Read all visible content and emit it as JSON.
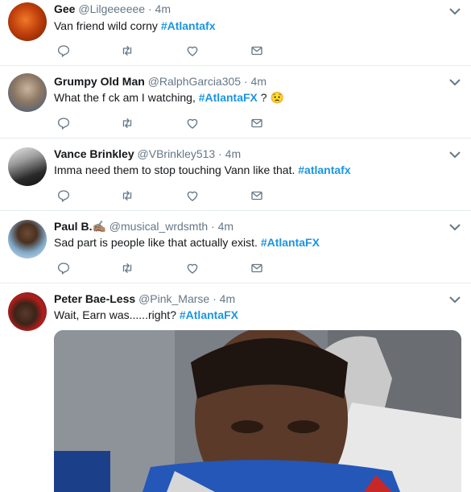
{
  "tweets": [
    {
      "name": "Gee",
      "handle": "@Lilgeeeeee",
      "separator": "·",
      "time": "4m",
      "text": "Van friend  wild corny ",
      "hashtag": "#Atlantafx",
      "after": ""
    },
    {
      "name": "Grumpy Old Man",
      "handle": "@RalphGarcia305",
      "separator": "·",
      "time": "4m",
      "text": "What the f  ck am I watching, ",
      "hashtag": "#AtlantaFX",
      "after": " ? ",
      "emoji": "😟"
    },
    {
      "name": "Vance Brinkley",
      "handle": "@VBrinkley513",
      "separator": "·",
      "time": "4m",
      "text": "Imma need them to stop touching Vann like that. ",
      "hashtag": "#atlantafx",
      "after": ""
    },
    {
      "name": "Paul B.",
      "name_emoji": "✍🏽",
      "handle": "@musical_wrdsmth",
      "separator": "·",
      "time": "4m",
      "text": "Sad part is people like that actually exist. ",
      "hashtag": "#AtlantaFX",
      "after": ""
    },
    {
      "name": "Peter Bae-Less",
      "handle": "@Pink_Marse",
      "separator": "·",
      "time": "4m",
      "text": "Wait, Earn was......right? ",
      "hashtag": "#AtlantaFX",
      "after": ""
    }
  ],
  "icons": {
    "reply": "reply-icon",
    "retweet": "retweet-icon",
    "like": "heart-icon",
    "dm": "envelope-icon",
    "caret": "chevron-down-icon"
  },
  "colors": {
    "hashtag": "#1b95e0",
    "muted": "#657786",
    "divider": "#e6ecf0"
  }
}
